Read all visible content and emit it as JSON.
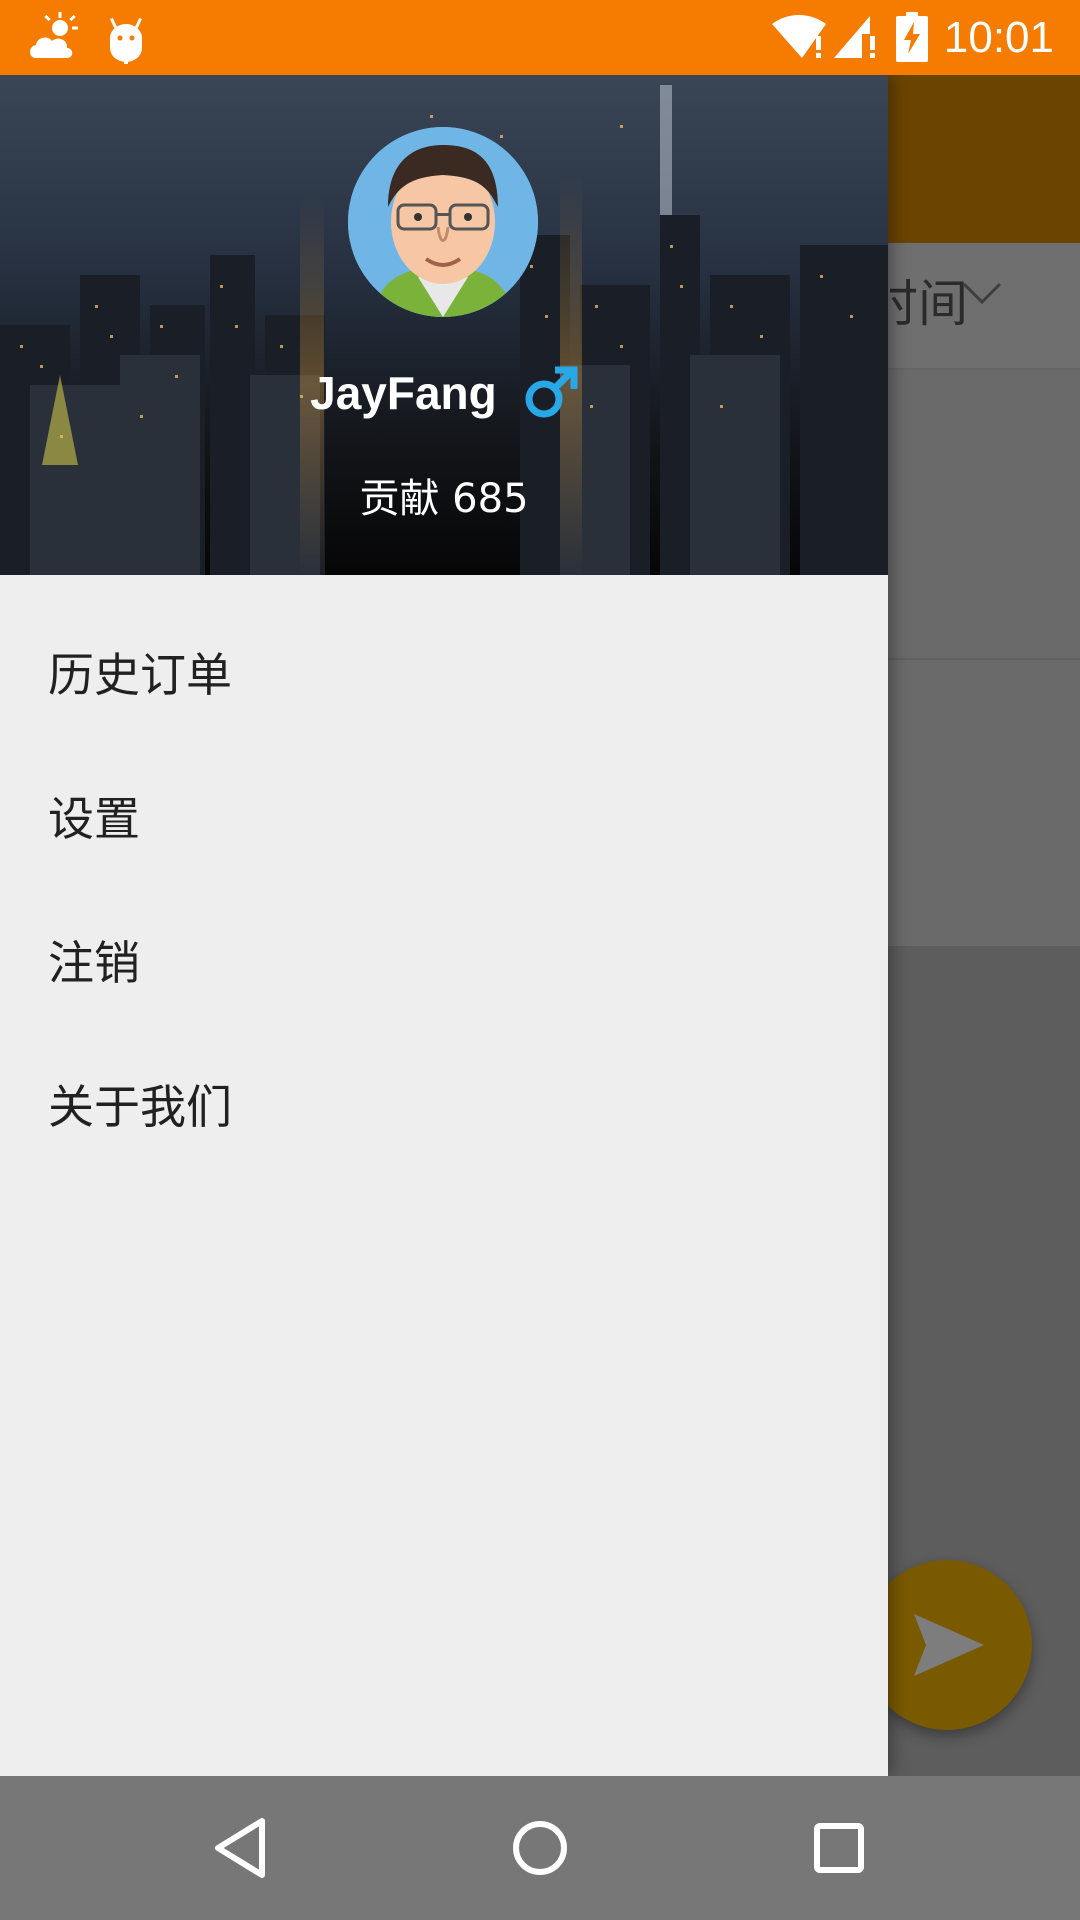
{
  "status_bar": {
    "time": "10:01",
    "icons": [
      "weather-cloud-sun-icon",
      "android-debug-icon",
      "wifi-alert-icon",
      "cell-signal-alert-icon",
      "battery-charging-icon"
    ],
    "background_color": "#f57c00"
  },
  "drawer": {
    "header": {
      "user_name": "JayFang",
      "gender_icon": "male-symbol-icon",
      "contribution": "贡献 685"
    },
    "menu_items": [
      {
        "label": "历史订单"
      },
      {
        "label": "设置"
      },
      {
        "label": "注销"
      },
      {
        "label": "关于我们"
      }
    ]
  },
  "background_page": {
    "filter_label": "时间",
    "fab_icon": "send-icon",
    "accent_color": "#f57c00"
  },
  "nav_bar": {
    "buttons": [
      "back-icon",
      "home-icon",
      "recents-icon"
    ]
  }
}
